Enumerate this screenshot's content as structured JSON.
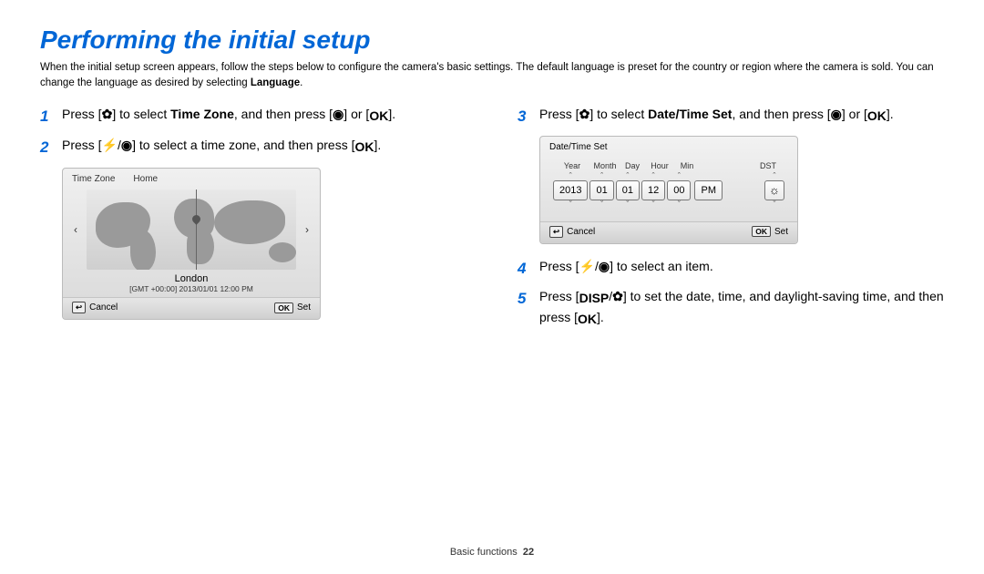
{
  "title": "Performing the initial setup",
  "intro_part1": "When the initial setup screen appears, follow the steps below to configure the camera's basic settings. The default language is preset for the country or region where the camera is sold. You can change the language as desired by selecting ",
  "intro_bold": "Language",
  "intro_part2": ".",
  "steps": {
    "s1_a": "Press [",
    "s1_icon1": "✿",
    "s1_b": "] to select ",
    "s1_bold": "Time Zone",
    "s1_c": ", and then press [",
    "s1_icon2": "◉",
    "s1_d": "] or [",
    "s1_icon3": "OK",
    "s1_e": "].",
    "s2_a": "Press [",
    "s2_icon1": "⚡",
    "s2_sep": "/",
    "s2_icon2": "◉",
    "s2_b": "] to select a time zone, and then press [",
    "s2_icon3": "OK",
    "s2_c": "].",
    "s3_a": "Press [",
    "s3_icon1": "✿",
    "s3_b": "] to select ",
    "s3_bold": "Date/Time Set",
    "s3_c": ", and then press [",
    "s3_icon2": "◉",
    "s3_d": "] or [",
    "s3_icon3": "OK",
    "s3_e": "].",
    "s4_a": "Press [",
    "s4_icon1": "⚡",
    "s4_sep": "/",
    "s4_icon2": "◉",
    "s4_b": "] to select an item.",
    "s5_a": "Press [",
    "s5_icon1": "DISP",
    "s5_sep": "/",
    "s5_icon2": "✿",
    "s5_b": "] to set the date, time, and daylight-saving time, and then press [",
    "s5_icon3": "OK",
    "s5_c": "]."
  },
  "tz": {
    "title": "Time Zone",
    "tab": "Home",
    "left": "‹",
    "right": "›",
    "city": "London",
    "gmt": "[GMT +00:00] 2013/01/01 12:00 PM",
    "cancel_icon": "↩",
    "cancel": "Cancel",
    "ok_icon": "OK",
    "set": "Set"
  },
  "dt": {
    "title": "Date/Time Set",
    "labels": {
      "year": "Year",
      "month": "Month",
      "day": "Day",
      "hour": "Hour",
      "min": "Min",
      "dst": "DST"
    },
    "values": {
      "year": "2013",
      "month": "01",
      "day": "01",
      "hour": "12",
      "min": "00",
      "ampm": "PM"
    },
    "up": "ˆ",
    "down": "ˇ",
    "sun": "☼",
    "cancel_icon": "↩",
    "cancel": "Cancel",
    "ok_icon": "OK",
    "set": "Set"
  },
  "footer": {
    "section": "Basic functions",
    "page": "22"
  }
}
